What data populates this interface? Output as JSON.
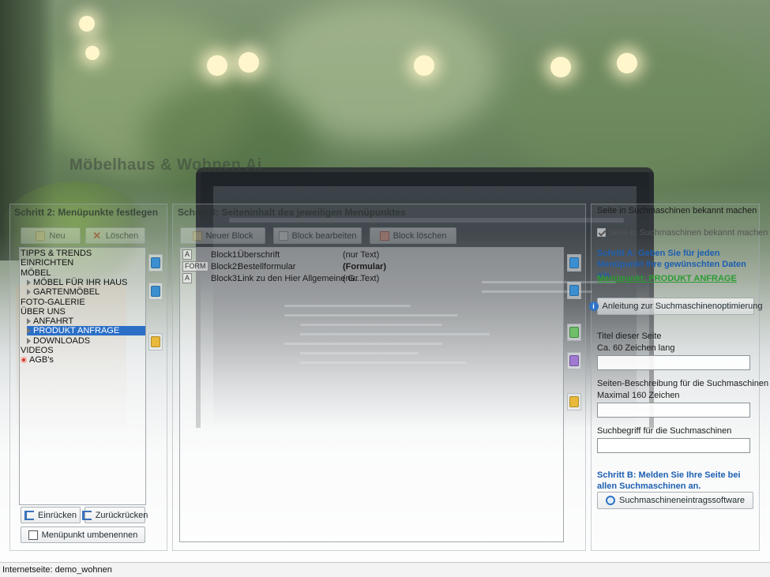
{
  "window": {
    "app_title": "Möbelhaus & Wohnen Ai",
    "status_bar": "Internetseite: demo_wohnen"
  },
  "menu_panel": {
    "heading": "Schritt 2: Menüpunkte festlegen",
    "new_label": "Neu",
    "delete_label": "Löschen",
    "tree": [
      {
        "label": "TIPPS & TRENDS",
        "level": 0,
        "marker": "none",
        "selected": false
      },
      {
        "label": "EINRICHTEN",
        "level": 0,
        "marker": "none",
        "selected": false
      },
      {
        "label": "MÖBEL",
        "level": 0,
        "marker": "none",
        "selected": false
      },
      {
        "label": "MÖBEL FÜR IHR HAUS",
        "level": 1,
        "marker": "arrow",
        "selected": false
      },
      {
        "label": "GARTENMÖBEL",
        "level": 1,
        "marker": "arrow",
        "selected": false
      },
      {
        "label": "FOTO-GALERIE",
        "level": 0,
        "marker": "none",
        "selected": false
      },
      {
        "label": "ÜBER UNS",
        "level": 0,
        "marker": "none",
        "selected": false
      },
      {
        "label": "ANFAHRT",
        "level": 1,
        "marker": "arrow",
        "selected": false
      },
      {
        "label": "PRODUKT ANFRAGE",
        "level": 1,
        "marker": "arrow",
        "selected": true
      },
      {
        "label": "DOWNLOADS",
        "level": 1,
        "marker": "arrow",
        "selected": false
      },
      {
        "label": "VIDEOS",
        "level": 0,
        "marker": "none",
        "selected": false
      },
      {
        "label": "AGB's",
        "level": 0,
        "marker": "red-dot",
        "selected": false
      }
    ],
    "indent_label": "Einrücken",
    "outdent_label": "Zurückrücken",
    "rename_label": "Menüpunkt umbenennen"
  },
  "content_panel": {
    "heading": "Schritt 3: Seiteninhalt des jeweiligen Menüpunktes",
    "new_block_label": "Neuer Block",
    "edit_block_label": "Block bearbeiten",
    "delete_block_label": "Block löschen",
    "blocks": [
      {
        "tag": "A",
        "name": "Block1:",
        "title": "Überschrift",
        "type": "(nur Text)",
        "bold": false
      },
      {
        "tag": "FORM",
        "name": "Block2:",
        "title": "Bestellformular",
        "type": "(Formular)",
        "bold": true
      },
      {
        "tag": "A",
        "name": "Block3:",
        "title": "Link zu den Hier Allgemeine G...",
        "type": "(nur Text)",
        "bold": false
      }
    ]
  },
  "seo_panel": {
    "heading": "Seite in Suchmaschinen bekannt machen",
    "checkbox_label": "Seite in Suchmaschinen bekannt machen",
    "step_a": "Schritt A: Geben Sie für jeden Menüpunkt Ihre gewünschten Daten ein.",
    "menu_item_line": "Menüpunkt: PRODUKT ANFRAGE",
    "guide_button": "Anleitung zur Suchmaschinenoptimierung",
    "title_label": "Titel dieser Seite",
    "title_hint": "Ca. 60 Zeichen lang",
    "title_value": "",
    "desc_label": "Seiten-Beschreibung für die Suchmaschinen",
    "desc_hint": "Maximal 160 Zeichen",
    "desc_value": "",
    "keyword_label": "Suchbegriff für die Suchmaschinen",
    "keyword_value": "",
    "step_b": "Schritt B: Melden Sie Ihre Seite bei allen Suchmaschinen an.",
    "submit_button": "Suchmaschineneintragssoftware"
  },
  "colors": {
    "accent_blue": "#1d5fb0",
    "accent_green": "#2c9b33",
    "selection": "#2b6fc7"
  }
}
